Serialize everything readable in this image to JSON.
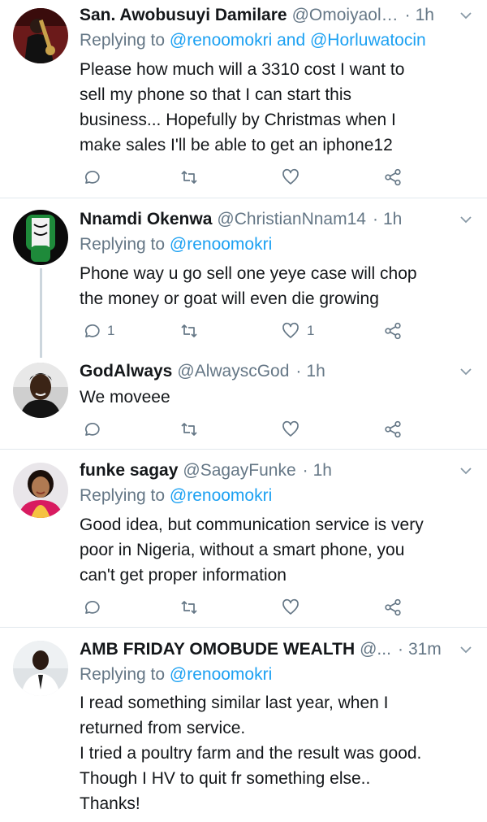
{
  "colors": {
    "text": "#14171a",
    "secondary": "#657786",
    "mention": "#1da1f2",
    "divider": "#e1e8ed"
  },
  "tweets": [
    {
      "name": "San. Awobusuyi Damilare",
      "handle": "@Omoiyaol…",
      "separator": "·",
      "time": "1h",
      "replying_prefix": "Replying to ",
      "mentions": "@renoomokri and @Horluwatocin",
      "body": [
        "Please how much will a 3310 cost I want to",
        "sell my phone so that I can start this",
        "business...  Hopefully by Christmas when I",
        "make sales I'll be able to get an iphone12"
      ],
      "reply_count": "",
      "like_count": ""
    },
    {
      "name": "Nnamdi Okenwa",
      "handle": "@ChristianNnam14",
      "separator": "·",
      "time": "1h",
      "replying_prefix": "Replying to ",
      "mentions": "@renoomokri",
      "body": [
        "Phone way u go sell one yeye case will chop",
        "the money or goat will even die growing"
      ],
      "reply_count": "1",
      "like_count": "1"
    },
    {
      "name": "GodAlways",
      "handle": "@AlwayscGod",
      "separator": "·",
      "time": "1h",
      "replying_prefix": "",
      "mentions": "",
      "body": [
        "We moveee"
      ],
      "reply_count": "",
      "like_count": ""
    },
    {
      "name": "funke sagay",
      "handle": "@SagayFunke",
      "separator": "·",
      "time": "1h",
      "replying_prefix": "Replying to ",
      "mentions": "@renoomokri",
      "body": [
        "Good idea, but communication service is very",
        "poor in Nigeria, without a smart phone, you",
        "can't get proper information"
      ],
      "reply_count": "",
      "like_count": ""
    },
    {
      "name": "AMB FRIDAY OMOBUDE WEALTH",
      "handle": "@...",
      "separator": "·",
      "time": "31m",
      "replying_prefix": "Replying to ",
      "mentions": "@renoomokri",
      "body": [
        "I read something similar last year, when I",
        "returned from service.",
        "I tried a poultry farm and the result was good.",
        "Though I HV to quit fr something else..",
        "Thanks!"
      ],
      "reply_count": "",
      "like_count": ""
    }
  ]
}
